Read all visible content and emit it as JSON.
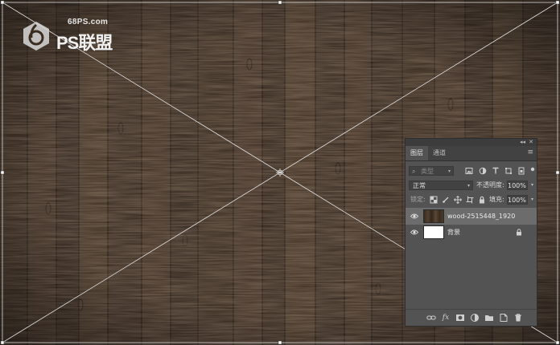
{
  "watermark": {
    "site": "68PS.com",
    "brand_text": "PS联盟"
  },
  "colors": {
    "wood_dark": "#2f231b",
    "wood_mid": "#4a3a2c",
    "panel_bg": "#535353",
    "selected_layer": "#6c6c6c"
  },
  "panel": {
    "collapse_glyph": "◂◂",
    "close_glyph": "✕",
    "menu_glyph": "≡",
    "tabs": [
      {
        "label": "图层",
        "active": true
      },
      {
        "label": "通道",
        "active": false
      }
    ],
    "filter": {
      "search_glyph": "⌕",
      "placeholder": "类型",
      "arrow": "▾",
      "icons": [
        "image-filter-icon",
        "adjustment-filter-icon",
        "type-filter-icon",
        "shape-filter-icon",
        "smart-object-filter-icon"
      ]
    },
    "blend_mode": "正常",
    "blend_arrow": "▾",
    "opacity_label": "不透明度:",
    "opacity_value": "100%",
    "lock_label": "锁定:",
    "fill_label": "填充:",
    "fill_value": "100%",
    "value_arrow": "▾",
    "layers": [
      {
        "name": "wood-2515448_1920",
        "visible": true,
        "selected": true,
        "locked": false,
        "thumb": "wood"
      },
      {
        "name": "背景",
        "visible": true,
        "selected": false,
        "locked": true,
        "thumb": "white"
      }
    ],
    "bottom_icons": [
      "link-layers-icon",
      "fx-icon",
      "add-mask-icon",
      "adjustment-layer-icon",
      "new-group-icon",
      "new-layer-icon",
      "delete-layer-icon"
    ],
    "fx_label": "fx"
  }
}
